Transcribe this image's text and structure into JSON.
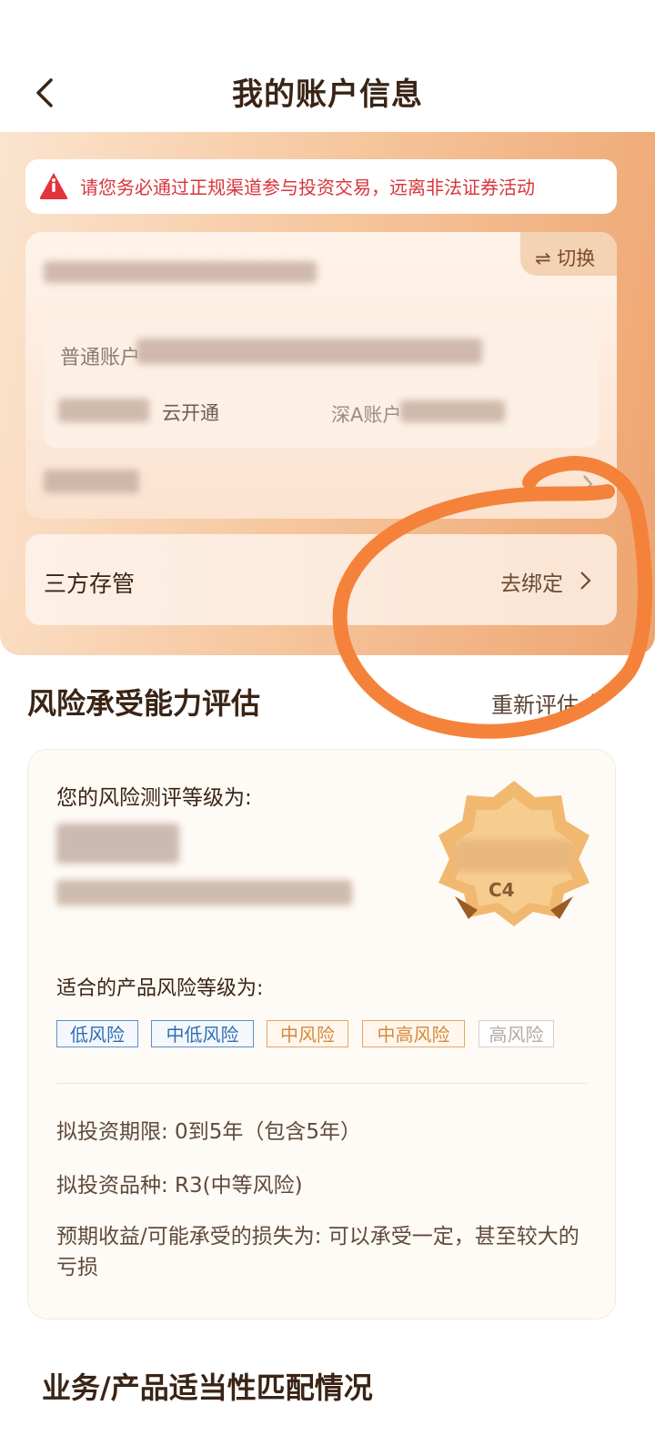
{
  "header": {
    "title": "我的账户信息",
    "back_icon": "chevron-left-icon"
  },
  "warning": {
    "text": "请您务必通过正规渠道参与投资交易，远离非法证券活动",
    "icon": "alert-triangle-icon"
  },
  "account": {
    "switch_label": "⇌ 切换",
    "type_label": "普通账户",
    "sh_label": "云开通",
    "sz_label": "深A账户"
  },
  "custody": {
    "title": "三方存管",
    "action": "去绑定"
  },
  "risk": {
    "section_title": "风险承受能力评估",
    "reassess_label": "重新评估",
    "level_prompt": "您的风险测评等级为:",
    "badge_code": "C4",
    "suitable_prompt": "适合的产品风险等级为:",
    "tags": [
      "低风险",
      "中低风险",
      "中风险",
      "中高风险",
      "高风险"
    ],
    "investment_period": "拟投资期限:  0到5年（包含5年）",
    "investment_type": "拟投资品种:  R3(中等风险)",
    "expected_loss": "预期收益/可能承受的损失为:  可以承受一定，甚至较大的亏损"
  },
  "bottom_section": {
    "title": "业务/产品适当性匹配情况"
  },
  "colors": {
    "accent_orange": "#ee9a5f",
    "warning_red": "#d9343a",
    "annotation_orange": "#f5823a"
  }
}
